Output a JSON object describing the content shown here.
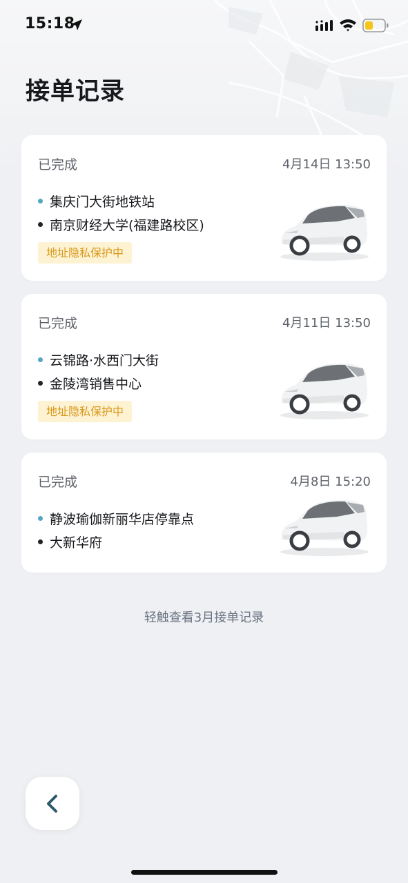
{
  "status_bar": {
    "time": "15:18",
    "icons": [
      "location-arrow-icon",
      "signal-icon",
      "wifi-icon",
      "battery-icon"
    ],
    "battery_color": "#f5c518"
  },
  "header": {
    "title": "接单记录"
  },
  "orders": [
    {
      "status": "已完成",
      "time": "4月14日 13:50",
      "start": "集庆门大街地铁站",
      "end": "南京财经大学(福建路校区)",
      "badge": "地址隐私保护中",
      "image": "white-suv-car-image"
    },
    {
      "status": "已完成",
      "time": "4月11日 13:50",
      "start": "云锦路·水西门大街",
      "end": "金陵湾销售中心",
      "badge": "地址隐私保护中",
      "image": "white-suv-car-image"
    },
    {
      "status": "已完成",
      "time": "4月8日 15:20",
      "start": "静波瑜伽新丽华店停靠点",
      "end": "大新华府",
      "image": "white-suv-car-image"
    }
  ],
  "footer": {
    "link_label": "轻触查看3月接单记录"
  },
  "nav": {
    "back_icon": "chevron-left-icon"
  },
  "colors": {
    "start_dot": "#53a7c4",
    "end_dot": "#222428",
    "badge_bg": "#fdf2d2",
    "badge_text": "#d89a1c",
    "back_icon": "#2c5a6b"
  }
}
